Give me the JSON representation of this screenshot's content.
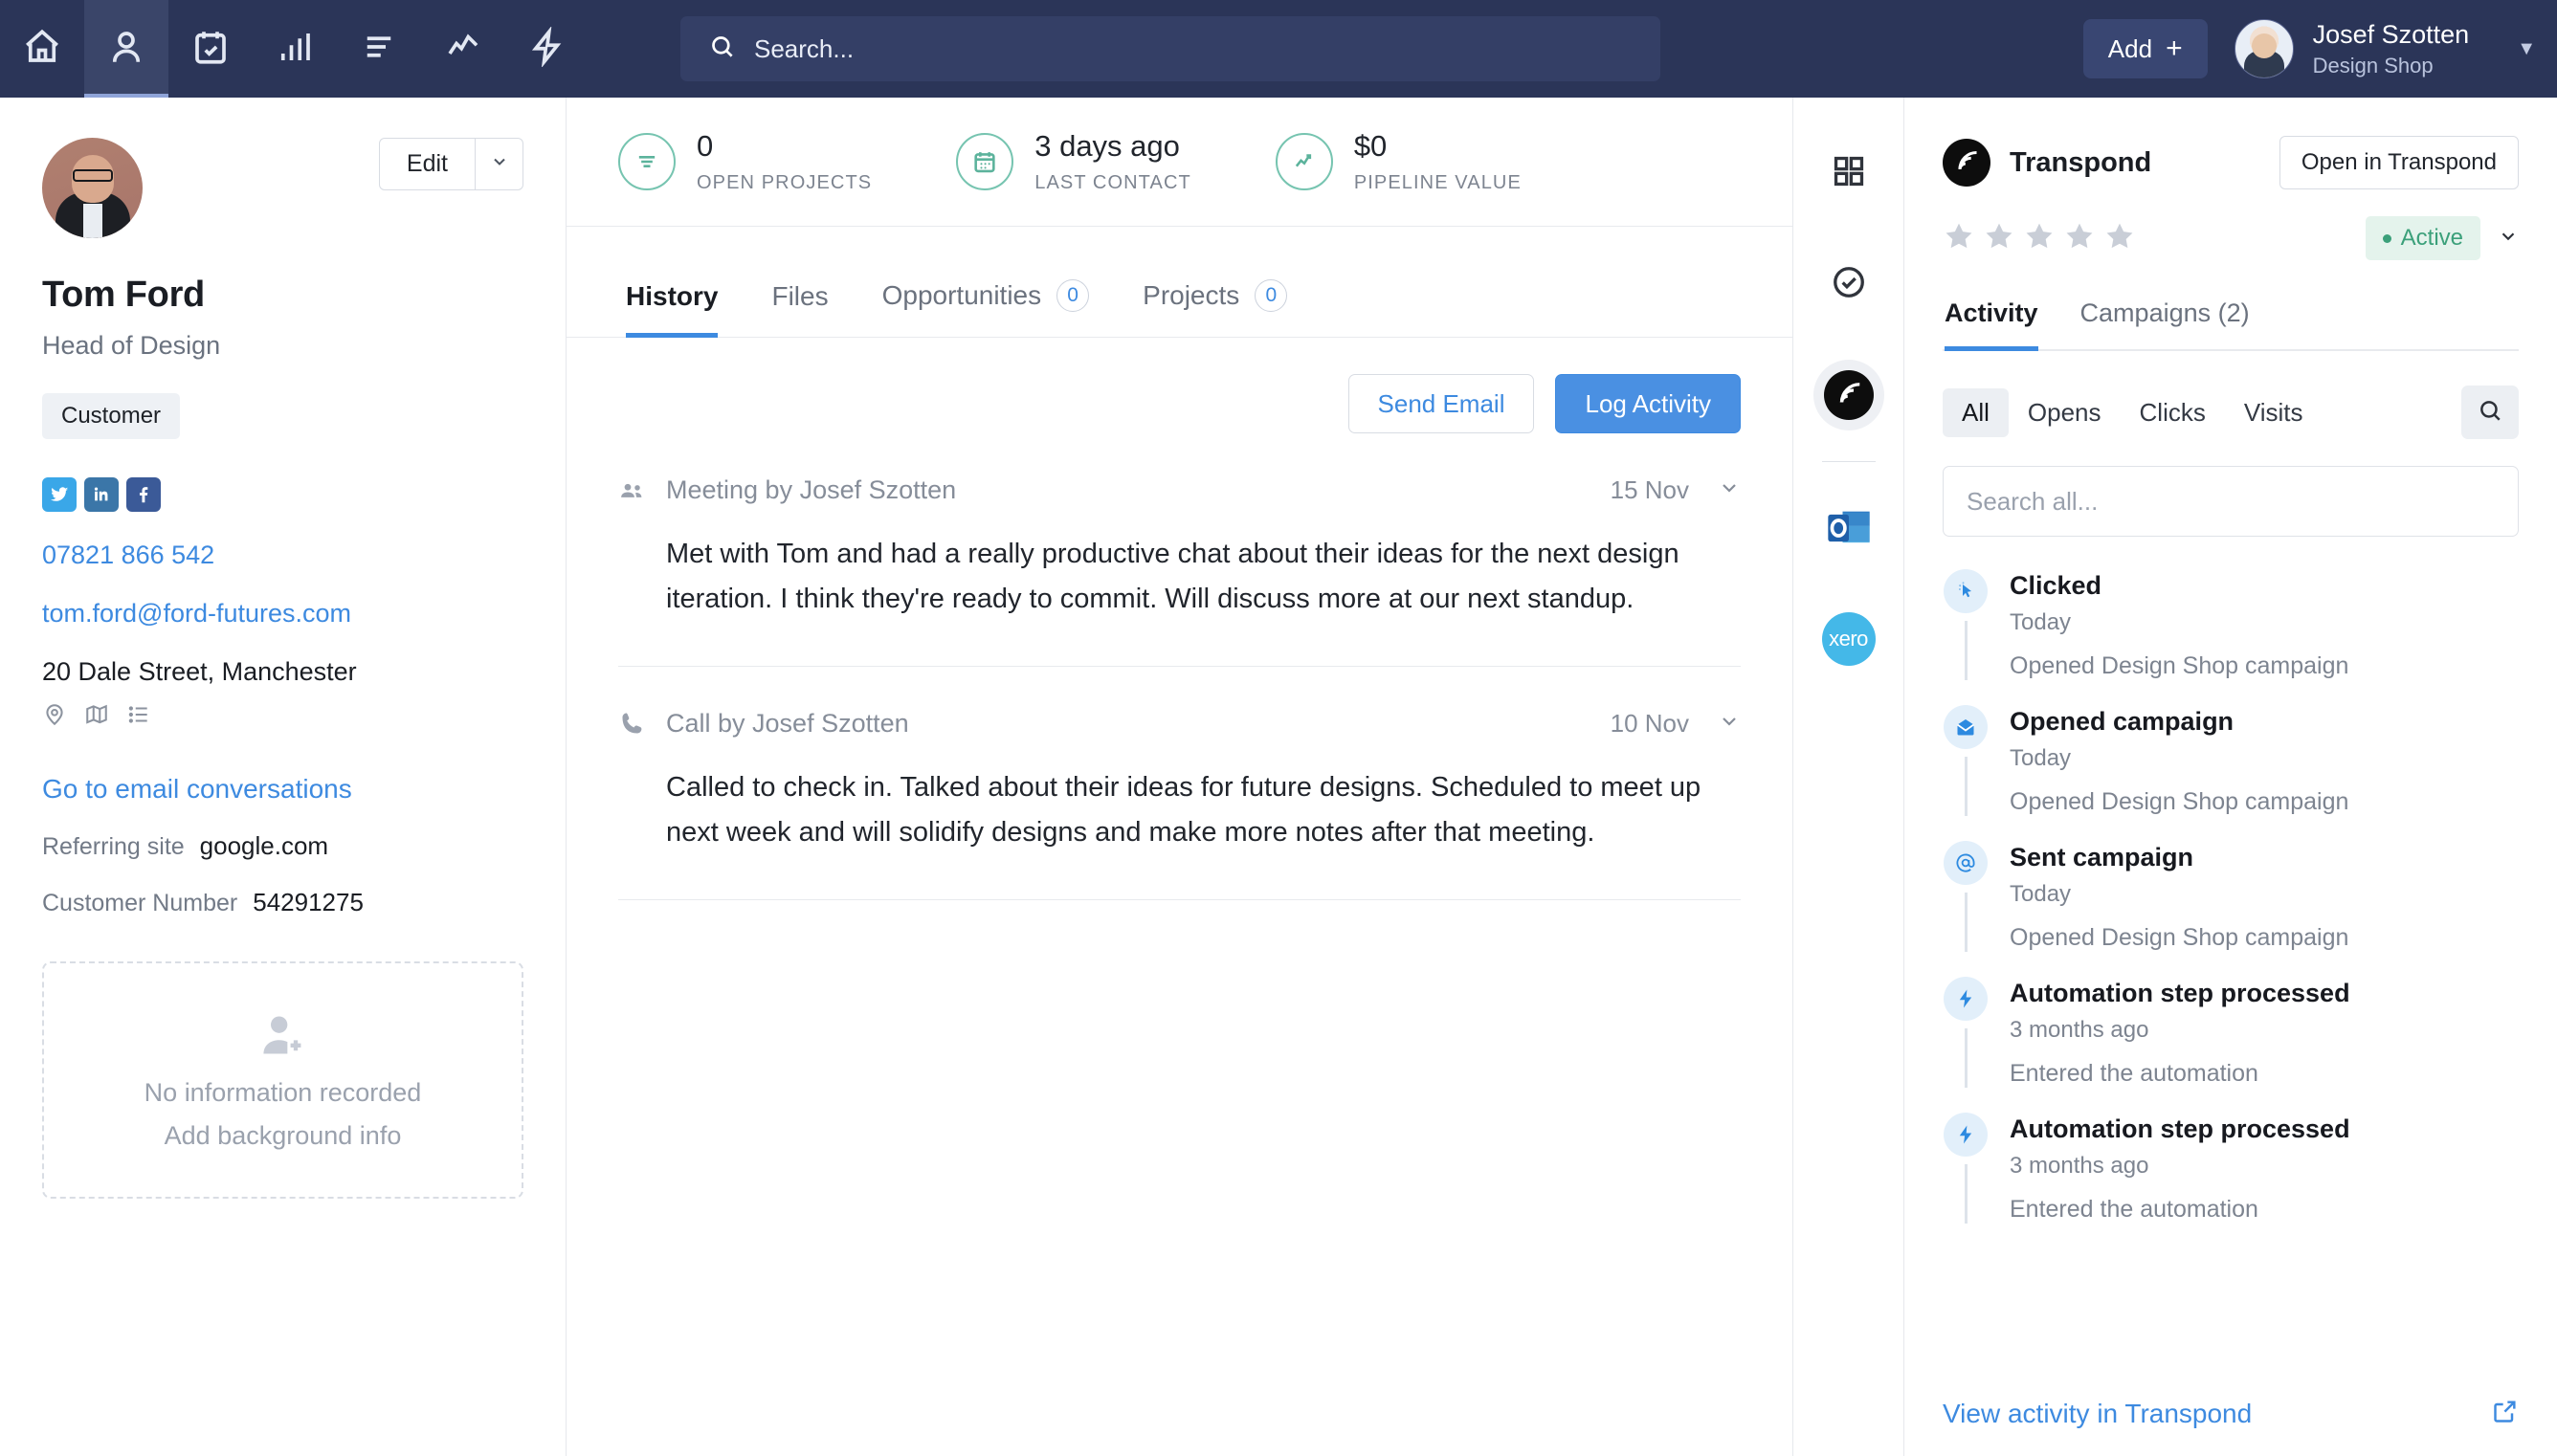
{
  "topbar": {
    "nav_items": [
      {
        "name": "home-icon",
        "label": "Home",
        "active": false
      },
      {
        "name": "contacts-icon",
        "label": "Contacts",
        "active": true
      },
      {
        "name": "calendar-check-icon",
        "label": "Activities",
        "active": false
      },
      {
        "name": "bar-chart-icon",
        "label": "Reports",
        "active": false
      },
      {
        "name": "list-icon",
        "label": "Projects",
        "active": false
      },
      {
        "name": "trend-line-icon",
        "label": "Pipeline",
        "active": false
      },
      {
        "name": "lightning-icon",
        "label": "Automations",
        "active": false
      }
    ],
    "search_placeholder": "Search...",
    "add_label": "Add",
    "add_plus": "+",
    "user_name": "Josef Szotten",
    "user_org": "Design Shop"
  },
  "profile": {
    "edit_label": "Edit",
    "name": "Tom Ford",
    "role": "Head of Design",
    "tag": "Customer",
    "socials": [
      "twitter-icon",
      "linkedin-icon",
      "facebook-icon"
    ],
    "phone": "07821 866 542",
    "email": "tom.ford@ford-futures.com",
    "address": "20 Dale Street, Manchester",
    "address_icons": [
      "map-pin-icon",
      "map-icon",
      "list-icon"
    ],
    "conversations_link": "Go to email conversations",
    "fields": [
      {
        "key": "Referring site",
        "value": "google.com"
      },
      {
        "key": "Customer Number",
        "value": "54291275"
      }
    ],
    "background_box": {
      "line1": "No information recorded",
      "line2": "Add background info"
    }
  },
  "main": {
    "stats": [
      {
        "value": "0",
        "label": "OPEN PROJECTS",
        "icon": "list-icon"
      },
      {
        "value": "3 days ago",
        "label": "LAST CONTACT",
        "icon": "calendar-icon"
      },
      {
        "value": "$0",
        "label": "PIPELINE VALUE",
        "icon": "trend-line-icon"
      }
    ],
    "tabs": [
      {
        "label": "History",
        "count": null,
        "active": true
      },
      {
        "label": "Files",
        "count": null,
        "active": false
      },
      {
        "label": "Opportunities",
        "count": "0",
        "active": false
      },
      {
        "label": "Projects",
        "count": "0",
        "active": false
      }
    ],
    "send_email_label": "Send Email",
    "log_activity_label": "Log Activity",
    "history": [
      {
        "icon": "people-icon",
        "title": "Meeting by Josef Szotten",
        "date": "15 Nov",
        "body": "Met with Tom and had a really productive chat about their ideas for the next design iteration. I think they're ready to commit. Will discuss more at our next standup."
      },
      {
        "icon": "phone-icon",
        "title": "Call by Josef Szotten",
        "date": "10 Nov",
        "body": "Called to check in. Talked about their ideas for future designs. Scheduled to meet up next week and will solidify designs and make more notes after that meeting."
      }
    ]
  },
  "rail": [
    {
      "name": "grid-icon",
      "selected": false
    },
    {
      "name": "check-circle-icon",
      "selected": false
    },
    {
      "name": "transpond-icon",
      "selected": true
    },
    {
      "name": "outlook-icon",
      "selected": false
    },
    {
      "name": "xero-icon",
      "selected": false,
      "label": "xero"
    }
  ],
  "right_panel": {
    "app_name": "Transpond",
    "open_button": "Open in Transpond",
    "star_count": 5,
    "status": "Active",
    "tabs": [
      {
        "label": "Activity",
        "active": true
      },
      {
        "label": "Campaigns (2)",
        "active": false
      }
    ],
    "filters": [
      {
        "label": "All",
        "active": true
      },
      {
        "label": "Opens",
        "active": false
      },
      {
        "label": "Clicks",
        "active": false
      },
      {
        "label": "Visits",
        "active": false
      }
    ],
    "search_placeholder": "Search all...",
    "feed": [
      {
        "icon": "cursor-click-icon",
        "title": "Clicked",
        "time": "Today",
        "desc": "Opened Design Shop campaign"
      },
      {
        "icon": "envelope-open-icon",
        "title": "Opened campaign",
        "time": "Today",
        "desc": "Opened Design Shop campaign"
      },
      {
        "icon": "at-sign-icon",
        "title": "Sent campaign",
        "time": "Today",
        "desc": "Opened Design Shop campaign"
      },
      {
        "icon": "lightning-icon",
        "title": "Automation step processed",
        "time": "3 months ago",
        "desc": "Entered the automation"
      },
      {
        "icon": "lightning-icon",
        "title": "Automation step processed",
        "time": "3 months ago",
        "desc": "Entered the automation"
      }
    ],
    "footer_link": "View activity in Transpond"
  },
  "colors": {
    "topbar_bg": "#2b3558",
    "accent_blue": "#3d8ae0",
    "primary_button": "#4a90e2",
    "stat_teal": "#5cb39c",
    "status_green": "#3ba07a"
  }
}
